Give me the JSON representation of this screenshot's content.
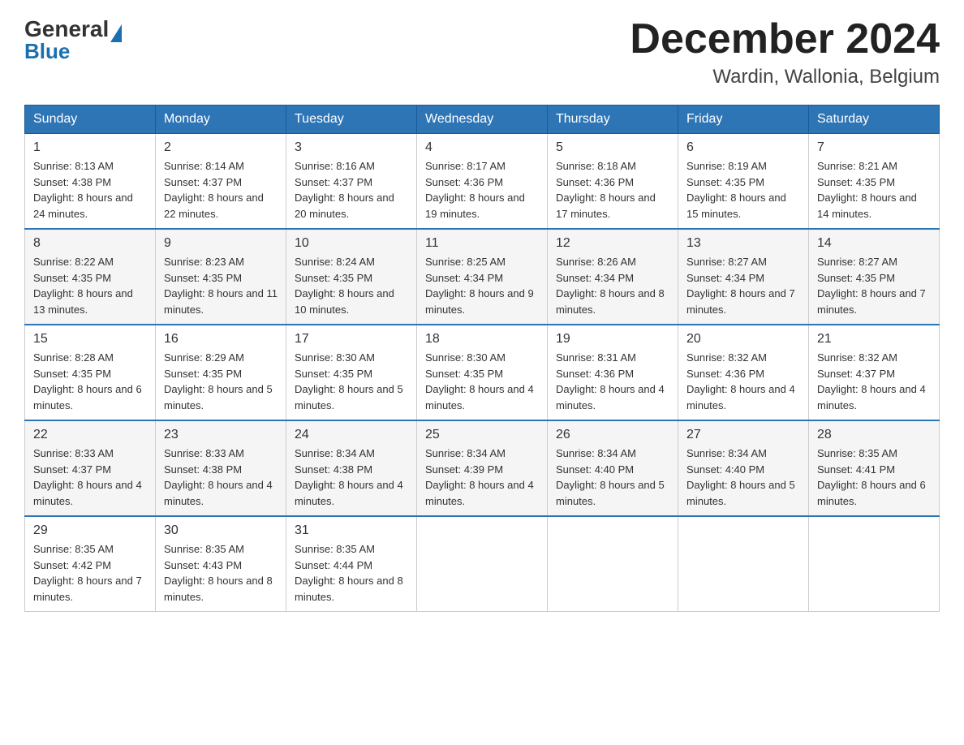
{
  "header": {
    "logo_general": "General",
    "logo_blue": "Blue",
    "title": "December 2024",
    "subtitle": "Wardin, Wallonia, Belgium"
  },
  "days_of_week": [
    "Sunday",
    "Monday",
    "Tuesday",
    "Wednesday",
    "Thursday",
    "Friday",
    "Saturday"
  ],
  "weeks": [
    [
      {
        "day": "1",
        "sunrise": "8:13 AM",
        "sunset": "4:38 PM",
        "daylight": "8 hours and 24 minutes."
      },
      {
        "day": "2",
        "sunrise": "8:14 AM",
        "sunset": "4:37 PM",
        "daylight": "8 hours and 22 minutes."
      },
      {
        "day": "3",
        "sunrise": "8:16 AM",
        "sunset": "4:37 PM",
        "daylight": "8 hours and 20 minutes."
      },
      {
        "day": "4",
        "sunrise": "8:17 AM",
        "sunset": "4:36 PM",
        "daylight": "8 hours and 19 minutes."
      },
      {
        "day": "5",
        "sunrise": "8:18 AM",
        "sunset": "4:36 PM",
        "daylight": "8 hours and 17 minutes."
      },
      {
        "day": "6",
        "sunrise": "8:19 AM",
        "sunset": "4:35 PM",
        "daylight": "8 hours and 15 minutes."
      },
      {
        "day": "7",
        "sunrise": "8:21 AM",
        "sunset": "4:35 PM",
        "daylight": "8 hours and 14 minutes."
      }
    ],
    [
      {
        "day": "8",
        "sunrise": "8:22 AM",
        "sunset": "4:35 PM",
        "daylight": "8 hours and 13 minutes."
      },
      {
        "day": "9",
        "sunrise": "8:23 AM",
        "sunset": "4:35 PM",
        "daylight": "8 hours and 11 minutes."
      },
      {
        "day": "10",
        "sunrise": "8:24 AM",
        "sunset": "4:35 PM",
        "daylight": "8 hours and 10 minutes."
      },
      {
        "day": "11",
        "sunrise": "8:25 AM",
        "sunset": "4:34 PM",
        "daylight": "8 hours and 9 minutes."
      },
      {
        "day": "12",
        "sunrise": "8:26 AM",
        "sunset": "4:34 PM",
        "daylight": "8 hours and 8 minutes."
      },
      {
        "day": "13",
        "sunrise": "8:27 AM",
        "sunset": "4:34 PM",
        "daylight": "8 hours and 7 minutes."
      },
      {
        "day": "14",
        "sunrise": "8:27 AM",
        "sunset": "4:35 PM",
        "daylight": "8 hours and 7 minutes."
      }
    ],
    [
      {
        "day": "15",
        "sunrise": "8:28 AM",
        "sunset": "4:35 PM",
        "daylight": "8 hours and 6 minutes."
      },
      {
        "day": "16",
        "sunrise": "8:29 AM",
        "sunset": "4:35 PM",
        "daylight": "8 hours and 5 minutes."
      },
      {
        "day": "17",
        "sunrise": "8:30 AM",
        "sunset": "4:35 PM",
        "daylight": "8 hours and 5 minutes."
      },
      {
        "day": "18",
        "sunrise": "8:30 AM",
        "sunset": "4:35 PM",
        "daylight": "8 hours and 4 minutes."
      },
      {
        "day": "19",
        "sunrise": "8:31 AM",
        "sunset": "4:36 PM",
        "daylight": "8 hours and 4 minutes."
      },
      {
        "day": "20",
        "sunrise": "8:32 AM",
        "sunset": "4:36 PM",
        "daylight": "8 hours and 4 minutes."
      },
      {
        "day": "21",
        "sunrise": "8:32 AM",
        "sunset": "4:37 PM",
        "daylight": "8 hours and 4 minutes."
      }
    ],
    [
      {
        "day": "22",
        "sunrise": "8:33 AM",
        "sunset": "4:37 PM",
        "daylight": "8 hours and 4 minutes."
      },
      {
        "day": "23",
        "sunrise": "8:33 AM",
        "sunset": "4:38 PM",
        "daylight": "8 hours and 4 minutes."
      },
      {
        "day": "24",
        "sunrise": "8:34 AM",
        "sunset": "4:38 PM",
        "daylight": "8 hours and 4 minutes."
      },
      {
        "day": "25",
        "sunrise": "8:34 AM",
        "sunset": "4:39 PM",
        "daylight": "8 hours and 4 minutes."
      },
      {
        "day": "26",
        "sunrise": "8:34 AM",
        "sunset": "4:40 PM",
        "daylight": "8 hours and 5 minutes."
      },
      {
        "day": "27",
        "sunrise": "8:34 AM",
        "sunset": "4:40 PM",
        "daylight": "8 hours and 5 minutes."
      },
      {
        "day": "28",
        "sunrise": "8:35 AM",
        "sunset": "4:41 PM",
        "daylight": "8 hours and 6 minutes."
      }
    ],
    [
      {
        "day": "29",
        "sunrise": "8:35 AM",
        "sunset": "4:42 PM",
        "daylight": "8 hours and 7 minutes."
      },
      {
        "day": "30",
        "sunrise": "8:35 AM",
        "sunset": "4:43 PM",
        "daylight": "8 hours and 8 minutes."
      },
      {
        "day": "31",
        "sunrise": "8:35 AM",
        "sunset": "4:44 PM",
        "daylight": "8 hours and 8 minutes."
      },
      null,
      null,
      null,
      null
    ]
  ],
  "labels": {
    "sunrise": "Sunrise:",
    "sunset": "Sunset:",
    "daylight": "Daylight:"
  }
}
